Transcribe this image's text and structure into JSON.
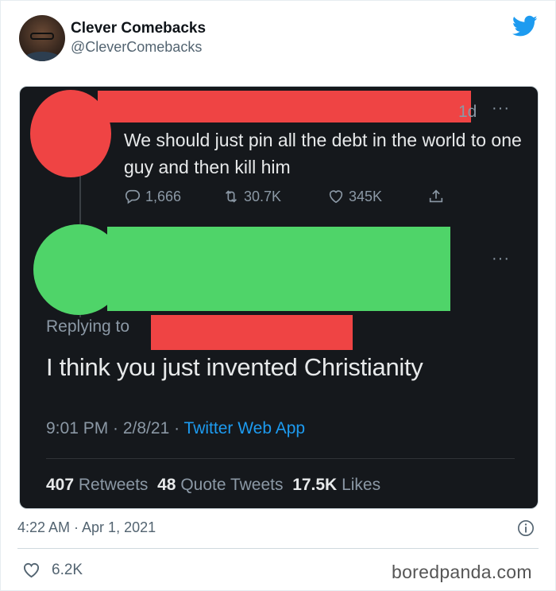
{
  "author": {
    "name": "Clever Comebacks",
    "handle": "@CleverComebacks"
  },
  "colors": {
    "twitter_blue": "#1d9bf0",
    "redaction_red": "#ef4444",
    "redaction_green": "#4fd469",
    "screenshot_bg": "#15181c"
  },
  "icons": {
    "brand": "twitter-bird-icon",
    "reply": "reply-icon",
    "retweet": "retweet-icon",
    "like": "heart-icon",
    "share": "share-icon",
    "info": "info-icon"
  },
  "screenshot": {
    "tweet1": {
      "time": "1d",
      "more": "···",
      "text": "We should just pin all the debt in the world to one guy and then kill him",
      "replies": "1,666",
      "retweets": "30.7K",
      "likes": "345K"
    },
    "tweet2": {
      "more": "···",
      "replying_to": "Replying to",
      "text": "I think you just invented Christianity",
      "time": "9:01 PM · 2/8/21 · ",
      "app": "Twitter Web App",
      "retweets_count": "407",
      "retweets_label": "Retweets",
      "quotes_count": "48",
      "quotes_label": "Quote Tweets",
      "likes_count": "17.5K",
      "likes_label": "Likes"
    }
  },
  "footer": {
    "timestamp": "4:22 AM · Apr 1, 2021",
    "likes": "6.2K",
    "watermark": "boredpanda.com"
  }
}
